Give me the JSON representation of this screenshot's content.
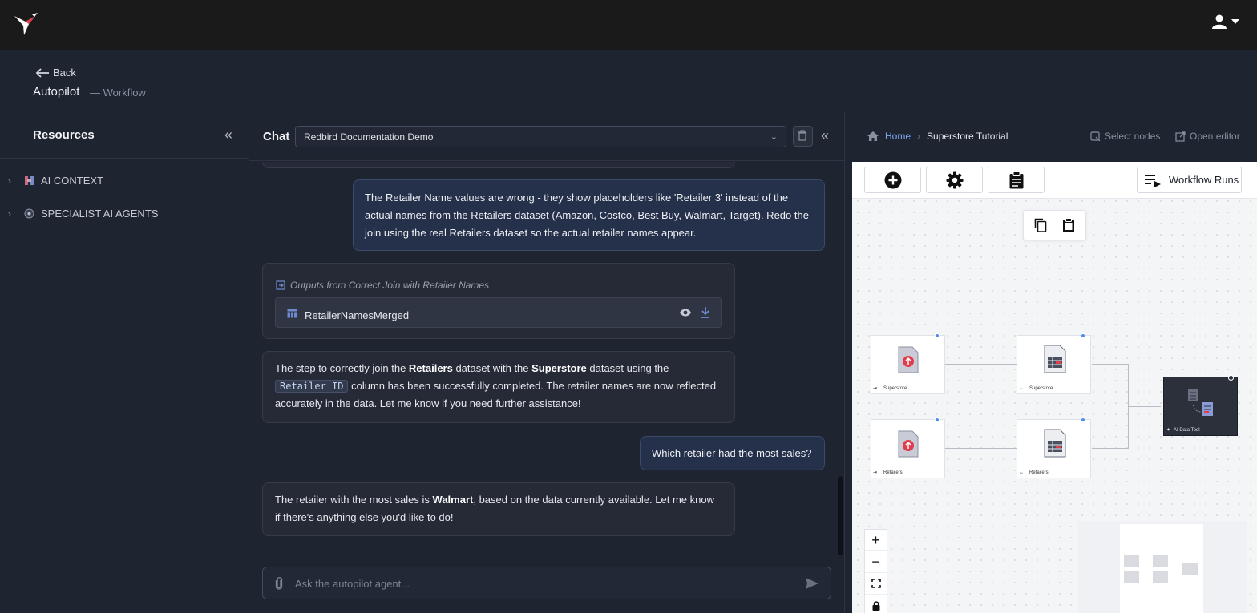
{
  "header": {
    "back_label": "Back",
    "title": "Autopilot",
    "subtitle": "— Workflow"
  },
  "resources": {
    "title": "Resources",
    "items": [
      {
        "label": "AI CONTEXT"
      },
      {
        "label": "SPECIALIST AI AGENTS"
      }
    ]
  },
  "chat": {
    "title": "Chat",
    "selected_chat": "Redbird Documentation Demo",
    "messages": {
      "user_1": "The Retailer Name values are wrong - they show placeholders like 'Retailer 3' instead of the actual names from the Retailers dataset (Amazon, Costco, Best Buy, Walmart, Target). Redo the join using the real Retailers dataset so the actual retailer names appear.",
      "outputs_label": "Outputs from Correct Join with Retailer Names",
      "output_file": "RetailerNamesMerged",
      "bot_1": {
        "p1": "The step to correctly join the ",
        "b1": "Retailers",
        "p2": " dataset with the ",
        "b2": "Superstore",
        "p3": " dataset using the ",
        "code": "Retailer ID",
        "p4": " column has been successfully completed. The retailer names are now reflected accurately in the data. Let me know if you need further assistance!"
      },
      "user_2": "Which retailer had the most sales?",
      "bot_2": {
        "p1": "The retailer with the most sales is ",
        "b1": "Walmart",
        "p2": ", based on the data currently available. Let me know if there's anything else you'd like to do!"
      }
    },
    "composer_placeholder": "Ask the autopilot agent..."
  },
  "workflow": {
    "breadcrumb": {
      "home": "Home",
      "current": "Superstore Tutorial"
    },
    "actions": {
      "select_nodes": "Select nodes",
      "open_editor": "Open editor"
    },
    "toolbar": {
      "runs_label": "Workflow Runs"
    },
    "nodes": {
      "upload_1": "Superstore",
      "dataset_1": "Superstore",
      "upload_2": "Retailers",
      "dataset_2": "Retailers",
      "tool": "AI Data Tool"
    }
  },
  "colors": {
    "accent": "#7fa7ef",
    "user_bubble": "#25304a",
    "bot_bubble": "#262a36",
    "canvas": "#f4f5f7"
  }
}
